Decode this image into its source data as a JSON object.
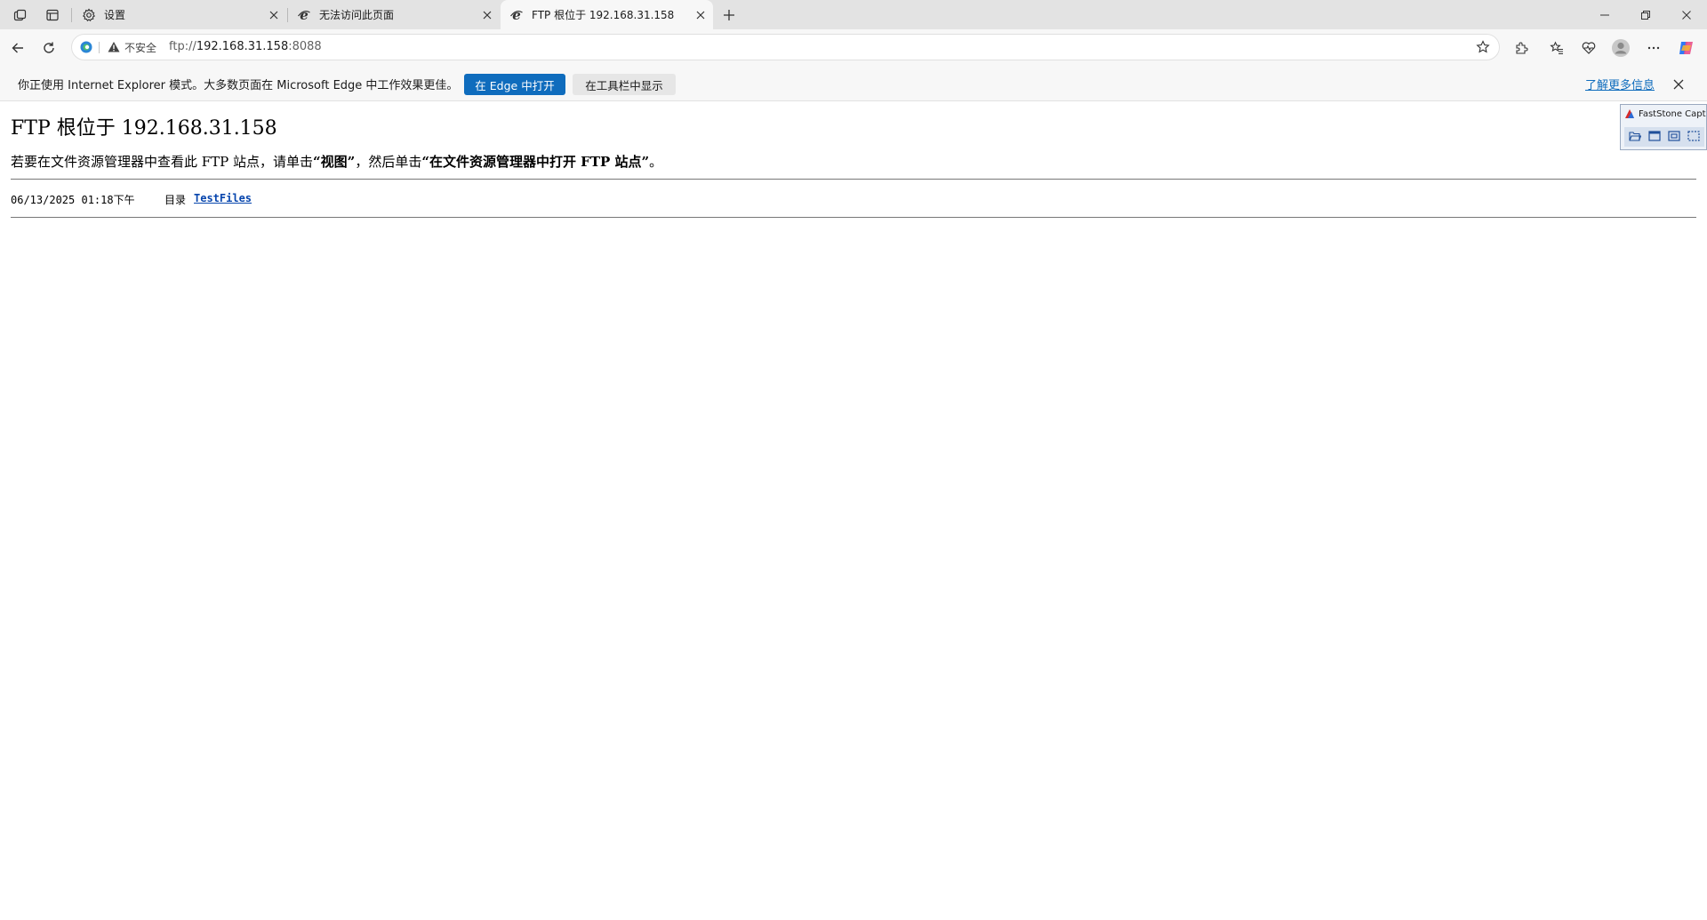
{
  "browser": {
    "tabs": [
      {
        "title": "设置",
        "icon": "gear-icon",
        "active": false
      },
      {
        "title": "无法访问此页面",
        "icon": "ie-icon",
        "active": false
      },
      {
        "title": "FTP 根位于 192.168.31.158",
        "icon": "ie-icon",
        "active": true
      }
    ],
    "address": {
      "security_label": "不安全",
      "url_prefix": "ftp://",
      "url_host": "192.168.31.158",
      "url_port": ":8088"
    }
  },
  "infobar": {
    "message": "你正使用 Internet Explorer 模式。大多数页面在 Microsoft Edge 中工作效果更佳。",
    "open_edge_label": "在 Edge 中打开",
    "show_toolbar_label": "在工具栏中显示",
    "learn_more_label": "了解更多信息"
  },
  "page": {
    "title": "FTP 根位于 192.168.31.158",
    "instruction_prefix": "若要在文件资源管理器中查看此 FTP 站点，请单击",
    "instruction_view": "“视图”",
    "instruction_middle": "，然后单击",
    "instruction_open": "“在文件资源管理器中打开 FTP 站点”",
    "instruction_suffix": "。",
    "entries": [
      {
        "date": "06/13/2025 01:18下午",
        "type": "目录",
        "name": "TestFiles"
      }
    ]
  },
  "faststone": {
    "title": "FastStone Capt"
  },
  "colors": {
    "accent": "#0f6cbd",
    "link": "#0645ad",
    "tabstrip": "#e3e3e3",
    "toolbar": "#f7f7f7"
  }
}
